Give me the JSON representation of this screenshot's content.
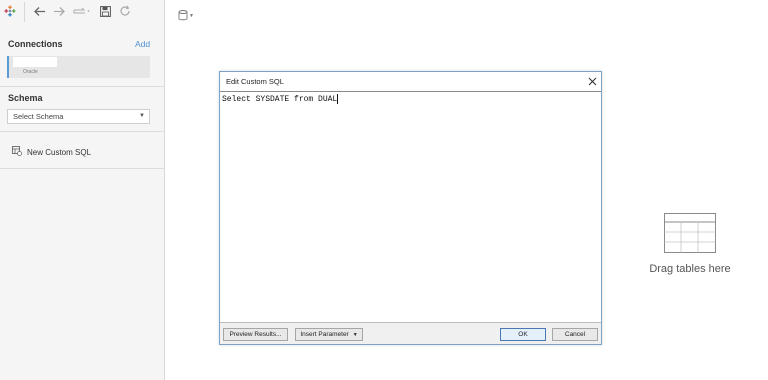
{
  "sidebar": {
    "connections_label": "Connections",
    "add_label": "Add",
    "connection": {
      "name": "",
      "type": "Oracle"
    },
    "schema_label": "Schema",
    "schema_select_value": "Select Schema",
    "new_custom_sql_label": "New Custom SQL"
  },
  "canvas": {
    "drag_text": "Drag tables here"
  },
  "dialog": {
    "title": "Edit Custom SQL",
    "query": "Select SYSDATE from DUAL",
    "buttons": {
      "preview": "Preview Results...",
      "insert_parameter": "Insert Parameter",
      "ok": "OK",
      "cancel": "Cancel"
    }
  },
  "colors": {
    "accent": "#5b9bd5",
    "link": "#4f8fcf",
    "dialog_border": "#7fa2c7"
  },
  "icons": [
    "tableau-logo-icon",
    "back-arrow-icon",
    "forward-arrow-icon",
    "redirect-icon",
    "save-icon",
    "refresh-icon",
    "database-icon",
    "custom-sql-icon",
    "table-placeholder-icon",
    "close-icon",
    "dropdown-arrow-icon"
  ]
}
